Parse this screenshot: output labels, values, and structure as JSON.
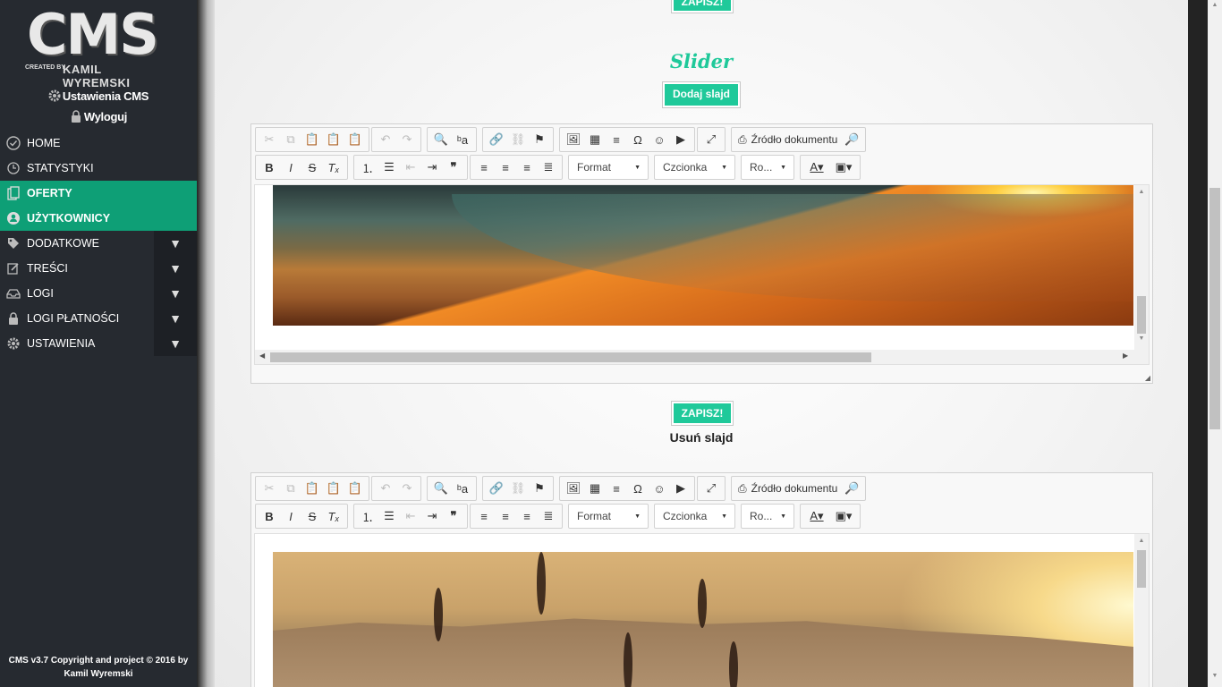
{
  "sidebar": {
    "logo": {
      "title": "CMS",
      "created_by": "CREATED BY",
      "author": "KAMIL WYREMSKI"
    },
    "settings_link": "Ustawienia CMS",
    "logout_link": "Wyloguj",
    "menu": [
      {
        "label": "HOME",
        "icon": "check-circle-icon",
        "active": false,
        "has_submenu": false
      },
      {
        "label": "STATYSTYKI",
        "icon": "clock-icon",
        "active": false,
        "has_submenu": false
      },
      {
        "label": "OFERTY",
        "icon": "documents-icon",
        "active": true,
        "has_submenu": false
      },
      {
        "label": "UŻYTKOWNICY",
        "icon": "users-icon",
        "active": true,
        "has_submenu": false
      },
      {
        "label": "DODATKOWE",
        "icon": "tag-icon",
        "active": false,
        "has_submenu": true
      },
      {
        "label": "TREŚCI",
        "icon": "edit-icon",
        "active": false,
        "has_submenu": true
      },
      {
        "label": "LOGI",
        "icon": "inbox-icon",
        "active": false,
        "has_submenu": true
      },
      {
        "label": "LOGI PŁATNOŚCI",
        "icon": "lock-icon",
        "active": false,
        "has_submenu": true
      },
      {
        "label": "USTAWIENIA",
        "icon": "gear-icon",
        "active": false,
        "has_submenu": true
      }
    ],
    "copyright_line1": "CMS v3.7 Copyright and project © 2016 by",
    "copyright_line2": "Kamil Wyremski"
  },
  "main": {
    "top_save_label": "ZAPISZ!",
    "section_title": "Slider",
    "add_slide_label": "Dodaj slajd",
    "save_label": "ZAPISZ!",
    "remove_slide_label": "Usuń slajd",
    "editor": {
      "source_label": "Źródło dokumentu",
      "format_label": "Format",
      "font_label": "Czcionka",
      "size_label": "Ro..."
    }
  },
  "colors": {
    "accent": "#1fc99a",
    "sidebar_bg": "#262a30",
    "active_item": "#0e9f76"
  }
}
